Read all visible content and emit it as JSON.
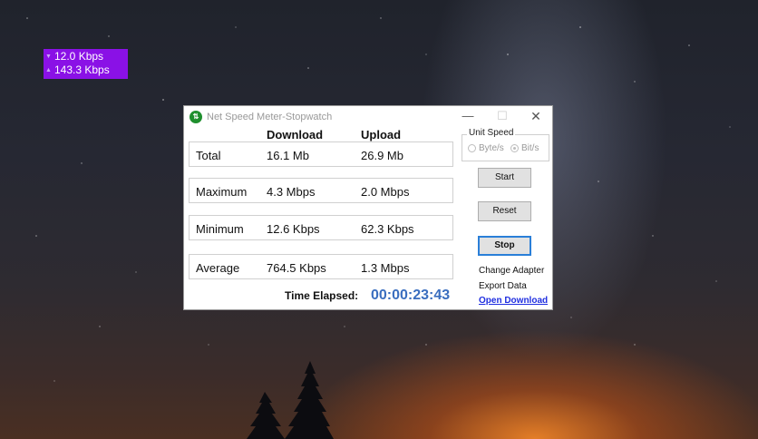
{
  "overlay": {
    "download_speed": "12.0 Kbps",
    "upload_speed": "143.3 Kbps"
  },
  "window": {
    "title": "Net Speed Meter-Stopwatch",
    "controls": {
      "minimize": "—",
      "maximize": "☐",
      "close": "✕"
    },
    "columns": {
      "download": "Download",
      "upload": "Upload"
    },
    "rows": [
      {
        "label": "Total",
        "download": "16.1 Mb",
        "upload": "26.9 Mb"
      },
      {
        "label": "Maximum",
        "download": "4.3 Mbps",
        "upload": "2.0 Mbps"
      },
      {
        "label": "Minimum",
        "download": "12.6 Kbps",
        "upload": "62.3 Kbps"
      },
      {
        "label": "Average",
        "download": "764.5 Kbps",
        "upload": "1.3 Mbps"
      }
    ],
    "elapsed": {
      "label": "Time Elapsed:",
      "value": "00:00:23:43"
    },
    "unit_speed": {
      "title": "Unit Speed",
      "options": [
        "Byte/s",
        "Bit/s"
      ],
      "selected": "Bit/s"
    },
    "buttons": {
      "start": "Start",
      "reset": "Reset",
      "stop": "Stop"
    },
    "links": {
      "change_adapter": "Change Adapter",
      "export_data": "Export Data",
      "open_download": "Open Download"
    }
  }
}
